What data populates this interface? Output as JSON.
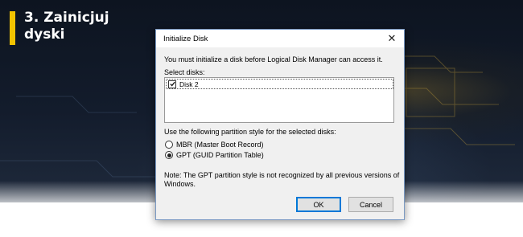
{
  "heading": {
    "line1": "3. Zainicjuj",
    "line2": "dyski"
  },
  "dialog": {
    "title": "Initialize Disk",
    "close_label": "✕",
    "intro": "You must initialize a disk before Logical Disk Manager can access it.",
    "select_label": "Select disks:",
    "disks": [
      {
        "label": "Disk 2",
        "checked": true
      }
    ],
    "partition_label": "Use the following partition style for the selected disks:",
    "options": [
      {
        "label": "MBR (Master Boot Record)",
        "selected": false
      },
      {
        "label": "GPT (GUID Partition Table)",
        "selected": true
      }
    ],
    "note_line1": "Note: The GPT partition style is not recognized by all previous versions of",
    "note_line2": "Windows.",
    "ok_label": "OK",
    "cancel_label": "Cancel"
  },
  "colors": {
    "accent": "#f2c300",
    "focus": "#0078d7"
  }
}
